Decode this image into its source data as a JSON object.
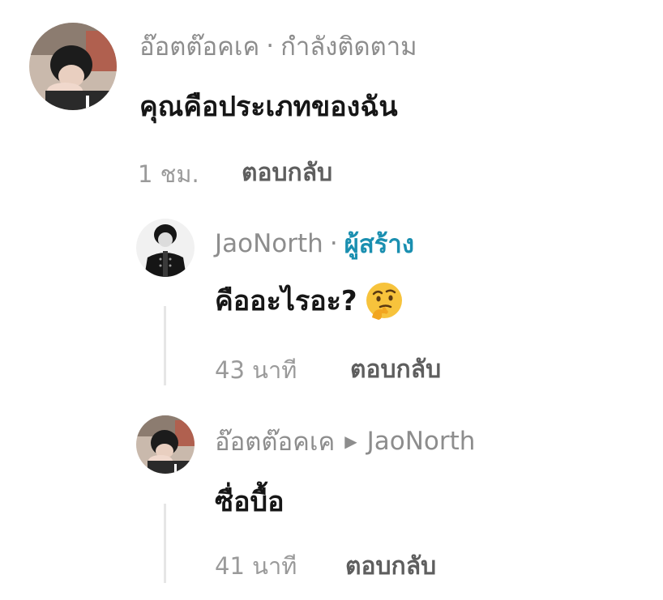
{
  "comment": {
    "username": "อ๊อตต๊อคเค",
    "separator": "·",
    "status": "กำลังติดตาม",
    "text": "คุณคือประเภทของฉัน",
    "time": "1 ชม.",
    "reply_label": "ตอบกลับ"
  },
  "replies": [
    {
      "username": "JaoNorth",
      "separator": "·",
      "badge": "ผู้สร้าง",
      "text": "คืออะไรอะ?",
      "emoji_icon": "thinking-face-icon",
      "time": "43 นาที",
      "reply_label": "ตอบกลับ"
    },
    {
      "username": "อ๊อตต๊อคเค",
      "reply_to": "JaoNorth",
      "text": "ซื่อบื้อ",
      "time": "41 นาที",
      "reply_label": "ตอบกลับ"
    }
  ],
  "colors": {
    "creator_badge": "#1a8fb0",
    "meta_text": "#8d8d8d",
    "thread_line": "#e6e6e6"
  }
}
